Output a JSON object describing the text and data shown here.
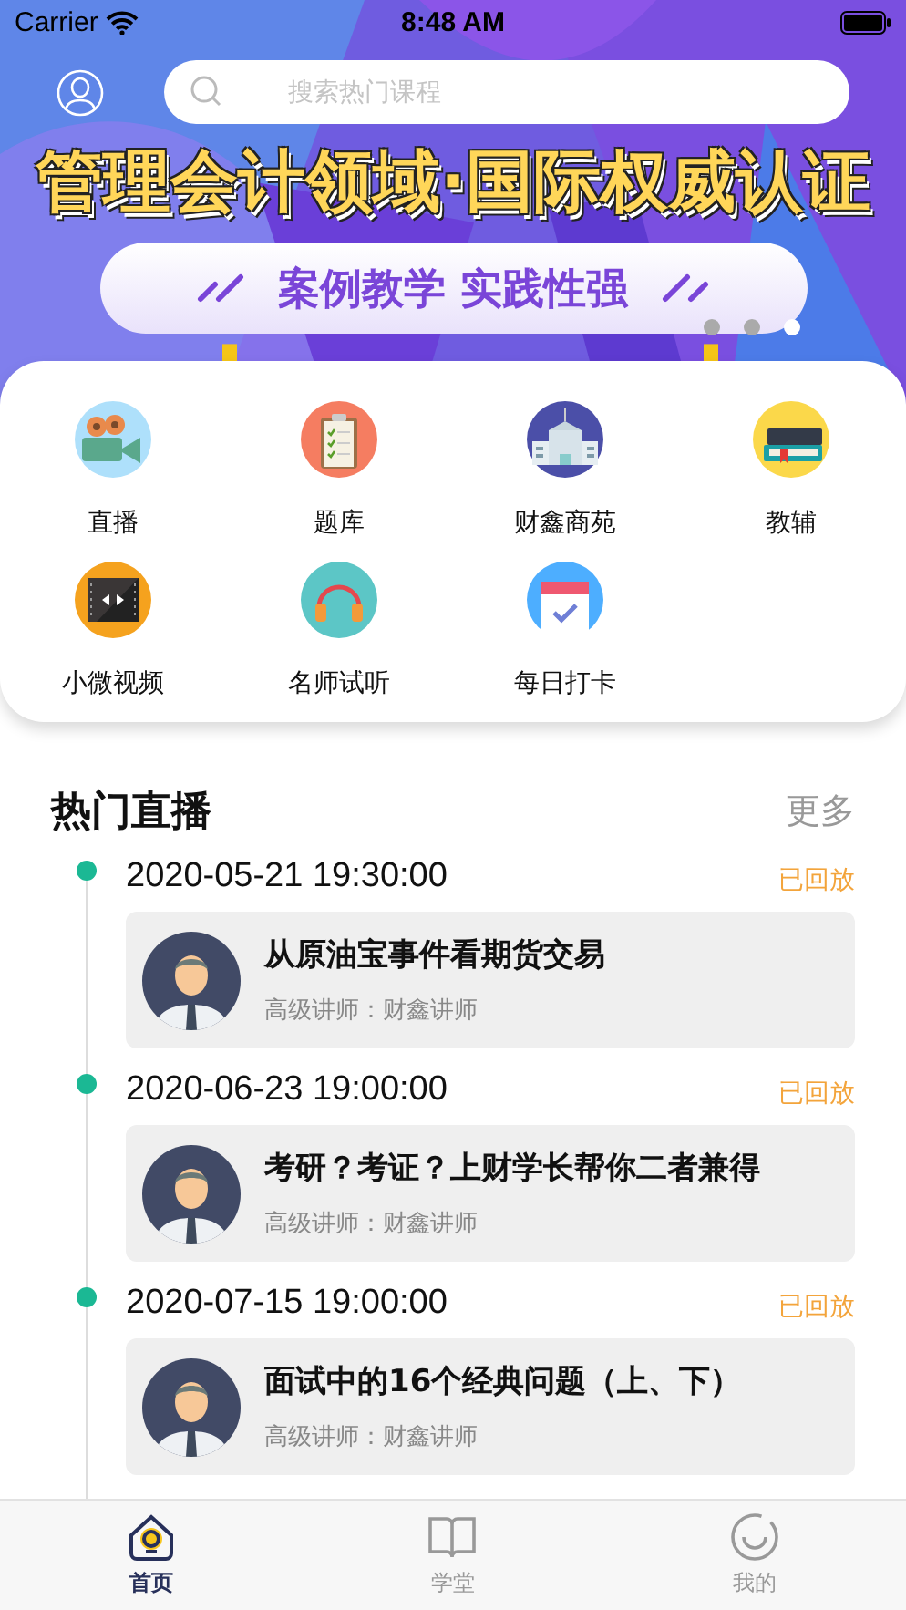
{
  "status_bar": {
    "carrier": "Carrier",
    "time": "8:48 AM"
  },
  "banner": {
    "search_placeholder": "搜索热门课程",
    "headline": "管理会计领域·国际权威认证",
    "tagline": "案例教学 实践性强",
    "dots": [
      {
        "selected": false
      },
      {
        "selected": false
      },
      {
        "selected": true
      }
    ]
  },
  "categories": [
    {
      "label": "直播"
    },
    {
      "label": "题库"
    },
    {
      "label": "财鑫商苑"
    },
    {
      "label": "教辅"
    },
    {
      "label": "小微视频"
    },
    {
      "label": "名师试听"
    },
    {
      "label": "每日打卡"
    }
  ],
  "section": {
    "title": "热门直播",
    "more": "更多"
  },
  "live": [
    {
      "date": "2020-05-21 19:30:00",
      "status": "已回放",
      "title": "从原油宝事件看期货交易",
      "teacher": "高级讲师：财鑫讲师"
    },
    {
      "date": "2020-06-23 19:00:00",
      "status": "已回放",
      "title": "考研？考证？上财学长帮你二者兼得",
      "teacher": "高级讲师：财鑫讲师"
    },
    {
      "date": "2020-07-15 19:00:00",
      "status": "已回放",
      "title": "面试中的16个经典问题（上、下）",
      "teacher": "高级讲师：财鑫讲师"
    }
  ],
  "tabs": [
    {
      "label": "首页",
      "selected": true
    },
    {
      "label": "学堂",
      "selected": false
    },
    {
      "label": "我的",
      "selected": false
    }
  ]
}
